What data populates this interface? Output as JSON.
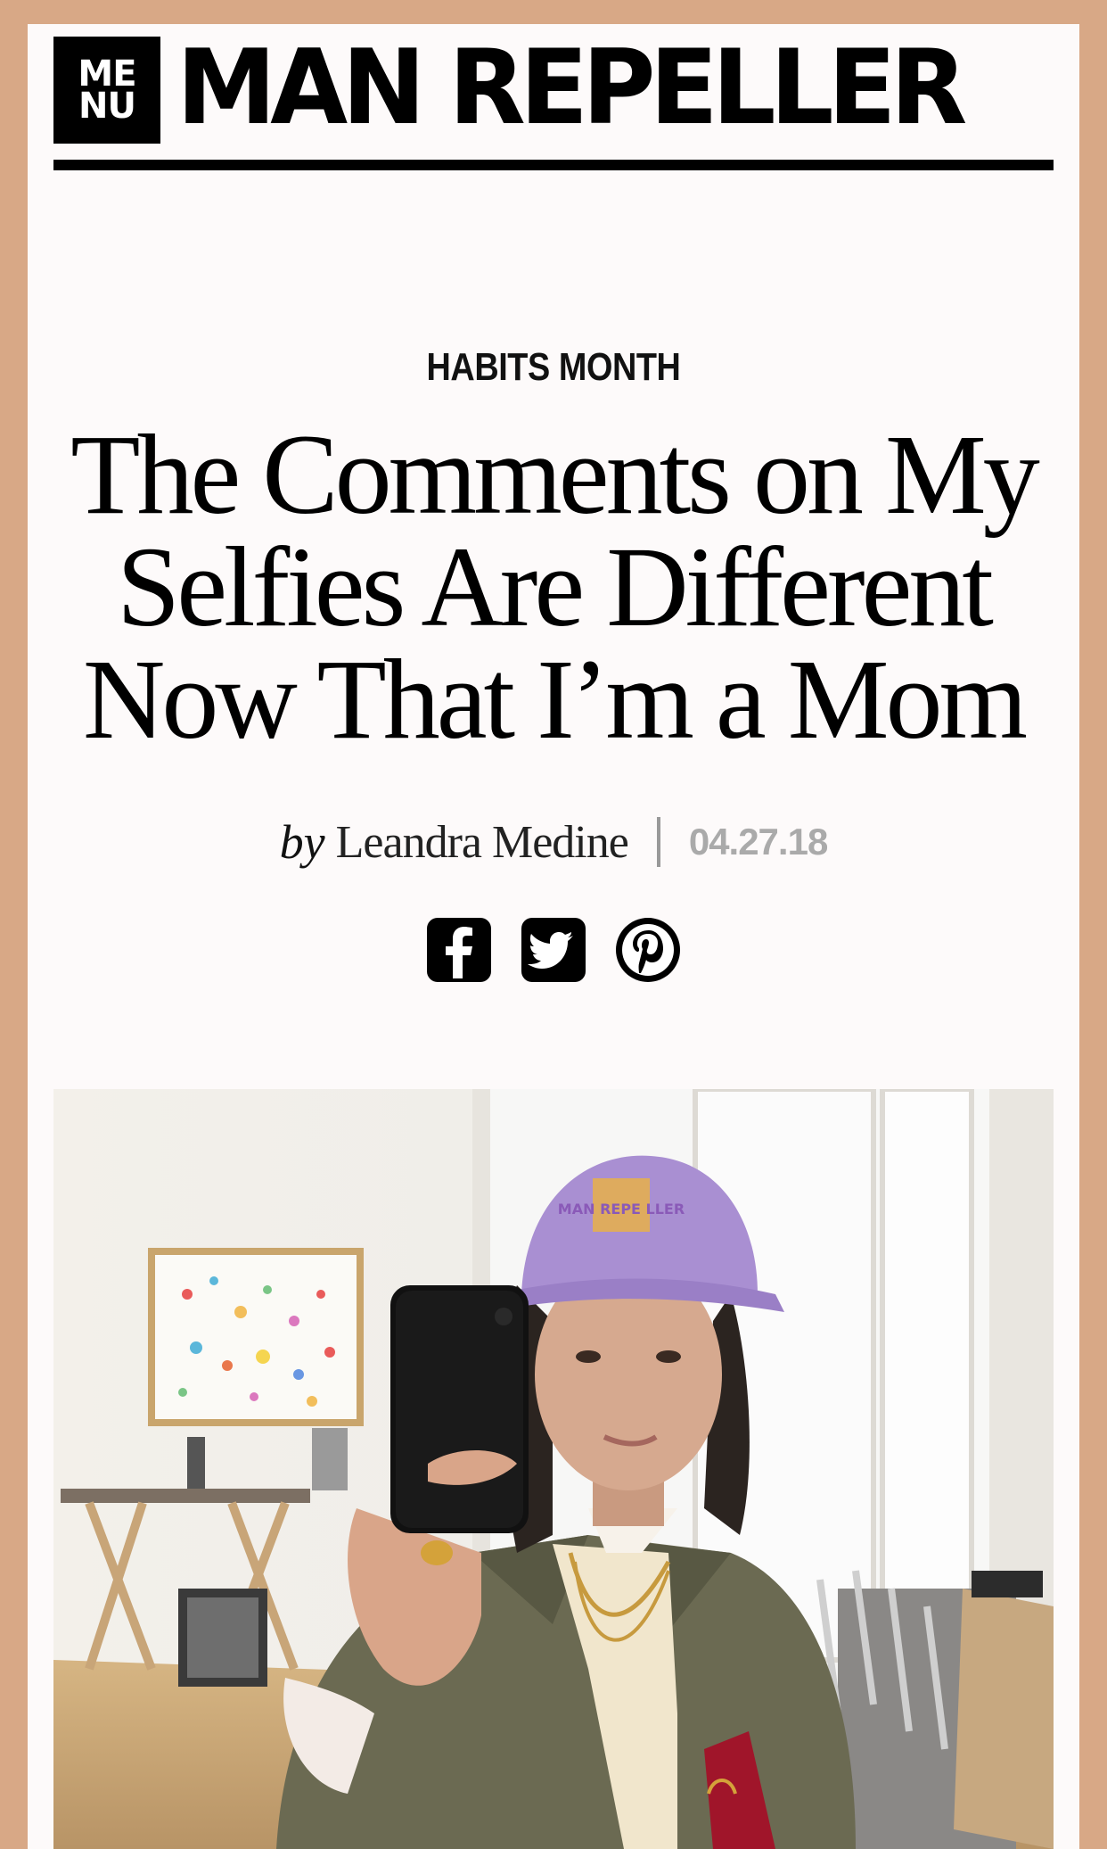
{
  "header": {
    "menu_line1": "ME",
    "menu_line2": "NU",
    "logo": "MAN REPELLER"
  },
  "article": {
    "kicker": "HABITS MONTH",
    "title": "The Comments on My Selfies Are Different Now That I’m a Mom",
    "by_prefix": "by",
    "author": "Leandra Medine",
    "date": "04.27.18"
  },
  "share": {
    "icons": [
      "facebook-icon",
      "twitter-icon",
      "pinterest-icon"
    ]
  },
  "hero": {
    "cap_text": "MAN REPE LLER"
  },
  "colors": {
    "page_border": "#d8a886",
    "page_background": "#fdfafa",
    "text": "#000000",
    "date": "#aaaaaa"
  }
}
